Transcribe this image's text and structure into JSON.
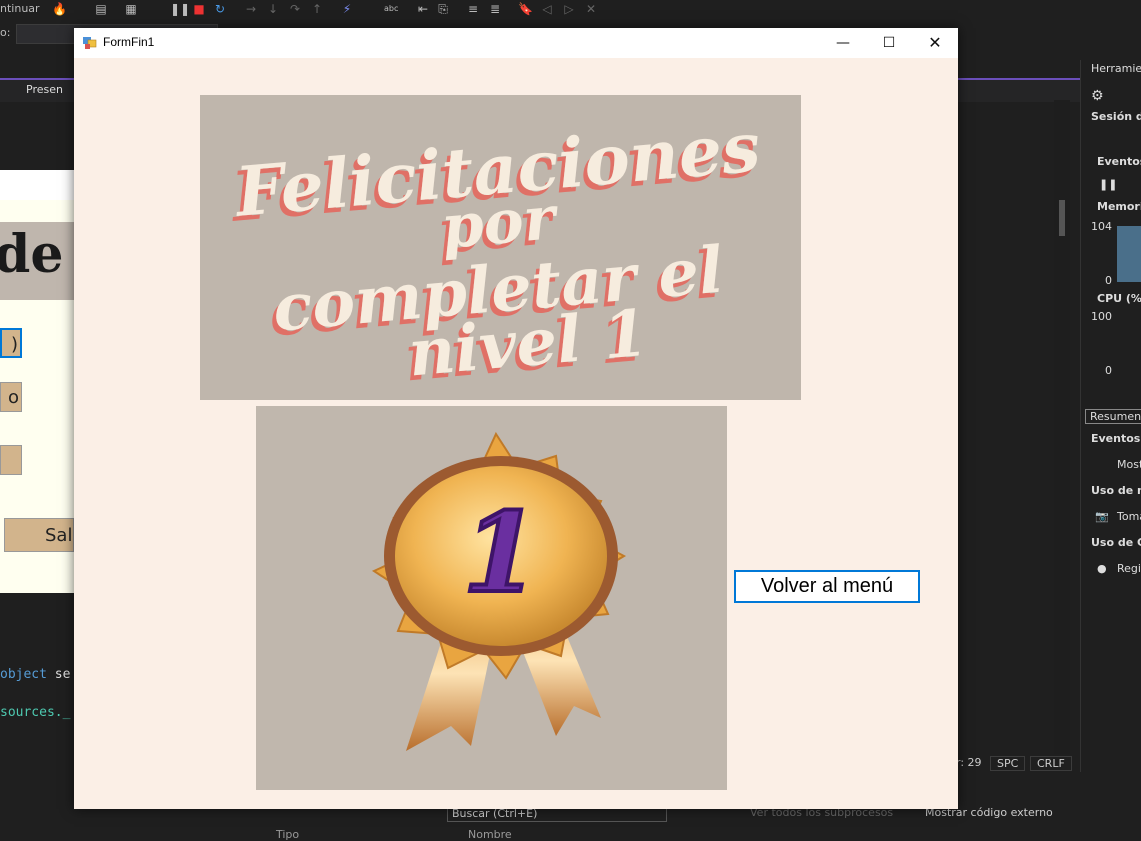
{
  "ide": {
    "toolbar_continue": "ntinuar",
    "search_label": "o:",
    "tab_preview": "Presen",
    "designer_title_fragment": "de",
    "designer_buttons": [
      ")",
      "o",
      ""
    ],
    "designer_exit": "Sal",
    "code_line1_kw": "object",
    "code_line1_rest": " se",
    "code_line2": "sources._",
    "right_panel": {
      "title": "Herramient",
      "session": "Sesión de",
      "events_header": "Eventos",
      "memory_header": "Memori",
      "memory_max": "104",
      "memory_min": "0",
      "cpu_header": "CPU (%",
      "cpu_max": "100",
      "cpu_min": "0",
      "summary_tab": "Resumen",
      "events_section": "Eventos",
      "events_item": "Most",
      "memory_section": "Uso de m",
      "memory_item": "Toma",
      "cpu_section": "Uso de CP",
      "cpu_item": "Regis"
    },
    "status": {
      "col": "r: 29",
      "spc": "SPC",
      "crlf": "CRLF"
    },
    "bottom": {
      "search_placeholder": "Buscar (Ctrl+E)",
      "view_threads": "Ver todos los subprocesos",
      "show_external": "Mostrar código externo",
      "col_type": "Tipo",
      "col_name": "Nombre"
    }
  },
  "form": {
    "title": "FormFin1",
    "congrats_lines": [
      "Felicitaciones",
      "por",
      "completar el",
      "nivel 1"
    ],
    "medal_number": "1",
    "back_button": "Volver al menú"
  },
  "colors": {
    "form_bg": "#fbefe6",
    "picture_bg": "#bfb6ac",
    "congrats_text": "#f6ecde",
    "congrats_shadow": "#e06f66",
    "button_border": "#0078d7"
  }
}
